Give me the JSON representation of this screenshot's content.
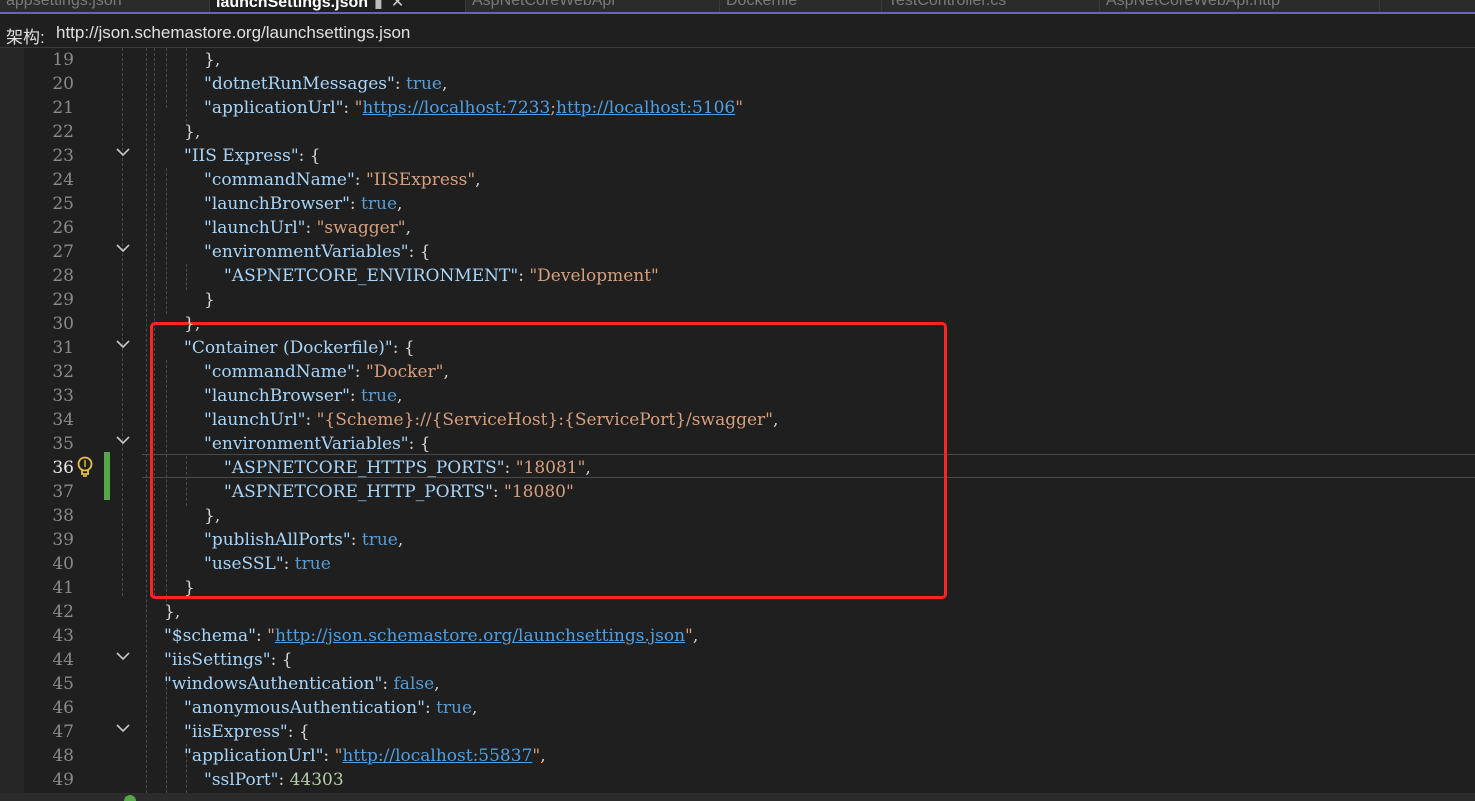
{
  "tabs": [
    {
      "label": "appsettings.json",
      "active": false
    },
    {
      "label": "launchSettings.json",
      "active": true,
      "pin_icon": "pin-icon",
      "close_icon": "close-icon"
    },
    {
      "label": "AspNetCoreWebApi",
      "active": false
    },
    {
      "label": "Dockerfile",
      "active": false
    },
    {
      "label": "TestController.cs",
      "active": false
    },
    {
      "label": "AspNetCoreWebApi.http",
      "active": false
    }
  ],
  "schema_bar": {
    "label": "架构:",
    "url": "http://json.schemastore.org/launchsettings.json"
  },
  "editor": {
    "current_line": 36,
    "lines": [
      {
        "n": "19",
        "fold": false,
        "tokens": [
          {
            "t": "},",
            "c": "p"
          }
        ]
      },
      {
        "n": "20",
        "fold": false,
        "tokens": [
          {
            "t": "\"dotnetRunMessages\"",
            "c": "k"
          },
          {
            "t": ": ",
            "c": "p"
          },
          {
            "t": "true",
            "c": "b"
          },
          {
            "t": ",",
            "c": "p"
          }
        ]
      },
      {
        "n": "21",
        "fold": false,
        "tokens": [
          {
            "t": "\"applicationUrl\"",
            "c": "k"
          },
          {
            "t": ": ",
            "c": "p"
          },
          {
            "t": "\"",
            "c": "s"
          },
          {
            "t": "https://localhost:7233",
            "c": "u"
          },
          {
            "t": ";",
            "c": "s"
          },
          {
            "t": "http://localhost:5106",
            "c": "u"
          },
          {
            "t": "\"",
            "c": "s"
          }
        ]
      },
      {
        "n": "22",
        "fold": false,
        "tokens": [
          {
            "t": "},",
            "c": "p"
          }
        ]
      },
      {
        "n": "23",
        "fold": true,
        "tokens": [
          {
            "t": "\"IIS Express\"",
            "c": "k"
          },
          {
            "t": ": {",
            "c": "p"
          }
        ]
      },
      {
        "n": "24",
        "fold": false,
        "tokens": [
          {
            "t": "\"commandName\"",
            "c": "k"
          },
          {
            "t": ": ",
            "c": "p"
          },
          {
            "t": "\"IISExpress\"",
            "c": "s"
          },
          {
            "t": ",",
            "c": "p"
          }
        ]
      },
      {
        "n": "25",
        "fold": false,
        "tokens": [
          {
            "t": "\"launchBrowser\"",
            "c": "k"
          },
          {
            "t": ": ",
            "c": "p"
          },
          {
            "t": "true",
            "c": "b"
          },
          {
            "t": ",",
            "c": "p"
          }
        ]
      },
      {
        "n": "26",
        "fold": false,
        "tokens": [
          {
            "t": "\"launchUrl\"",
            "c": "k"
          },
          {
            "t": ": ",
            "c": "p"
          },
          {
            "t": "\"swagger\"",
            "c": "s"
          },
          {
            "t": ",",
            "c": "p"
          }
        ]
      },
      {
        "n": "27",
        "fold": true,
        "tokens": [
          {
            "t": "\"environmentVariables\"",
            "c": "k"
          },
          {
            "t": ": {",
            "c": "p"
          }
        ]
      },
      {
        "n": "28",
        "fold": false,
        "tokens": [
          {
            "t": "\"ASPNETCORE_ENVIRONMENT\"",
            "c": "k"
          },
          {
            "t": ": ",
            "c": "p"
          },
          {
            "t": "\"Development\"",
            "c": "s"
          }
        ]
      },
      {
        "n": "29",
        "fold": false,
        "tokens": [
          {
            "t": "}",
            "c": "p"
          }
        ]
      },
      {
        "n": "30",
        "fold": false,
        "tokens": [
          {
            "t": "},",
            "c": "p"
          }
        ]
      },
      {
        "n": "31",
        "fold": true,
        "tokens": [
          {
            "t": "\"Container (Dockerfile)\"",
            "c": "k"
          },
          {
            "t": ": {",
            "c": "p"
          }
        ]
      },
      {
        "n": "32",
        "fold": false,
        "tokens": [
          {
            "t": "\"commandName\"",
            "c": "k"
          },
          {
            "t": ": ",
            "c": "p"
          },
          {
            "t": "\"Docker\"",
            "c": "s"
          },
          {
            "t": ",",
            "c": "p"
          }
        ]
      },
      {
        "n": "33",
        "fold": false,
        "tokens": [
          {
            "t": "\"launchBrowser\"",
            "c": "k"
          },
          {
            "t": ": ",
            "c": "p"
          },
          {
            "t": "true",
            "c": "b"
          },
          {
            "t": ",",
            "c": "p"
          }
        ]
      },
      {
        "n": "34",
        "fold": false,
        "tokens": [
          {
            "t": "\"launchUrl\"",
            "c": "k"
          },
          {
            "t": ": ",
            "c": "p"
          },
          {
            "t": "\"{Scheme}://{ServiceHost}:{ServicePort}/swagger\"",
            "c": "s"
          },
          {
            "t": ",",
            "c": "p"
          }
        ]
      },
      {
        "n": "35",
        "fold": true,
        "tokens": [
          {
            "t": "\"environmentVariables\"",
            "c": "k"
          },
          {
            "t": ": {",
            "c": "p"
          }
        ]
      },
      {
        "n": "36",
        "fold": false,
        "tokens": [
          {
            "t": "\"ASPNETCORE_HTTPS_PORTS\"",
            "c": "k"
          },
          {
            "t": ": ",
            "c": "p"
          },
          {
            "t": "\"18081\"",
            "c": "s"
          },
          {
            "t": ",",
            "c": "p"
          }
        ]
      },
      {
        "n": "37",
        "fold": false,
        "tokens": [
          {
            "t": "\"ASPNETCORE_HTTP_PORTS\"",
            "c": "k"
          },
          {
            "t": ": ",
            "c": "p"
          },
          {
            "t": "\"18080\"",
            "c": "s"
          }
        ]
      },
      {
        "n": "38",
        "fold": false,
        "tokens": [
          {
            "t": "},",
            "c": "p"
          }
        ]
      },
      {
        "n": "39",
        "fold": false,
        "tokens": [
          {
            "t": "\"publishAllPorts\"",
            "c": "k"
          },
          {
            "t": ": ",
            "c": "p"
          },
          {
            "t": "true",
            "c": "b"
          },
          {
            "t": ",",
            "c": "p"
          }
        ]
      },
      {
        "n": "40",
        "fold": false,
        "tokens": [
          {
            "t": "\"useSSL\"",
            "c": "k"
          },
          {
            "t": ": ",
            "c": "p"
          },
          {
            "t": "true",
            "c": "b"
          }
        ]
      },
      {
        "n": "41",
        "fold": false,
        "tokens": [
          {
            "t": "}",
            "c": "p"
          }
        ]
      },
      {
        "n": "42",
        "fold": false,
        "tokens": [
          {
            "t": "},",
            "c": "p"
          }
        ]
      },
      {
        "n": "43",
        "fold": false,
        "tokens": [
          {
            "t": "\"$schema\"",
            "c": "k"
          },
          {
            "t": ": ",
            "c": "p"
          },
          {
            "t": "\"",
            "c": "s"
          },
          {
            "t": "http://json.schemastore.org/launchsettings.json",
            "c": "u"
          },
          {
            "t": "\"",
            "c": "s"
          },
          {
            "t": ",",
            "c": "p"
          }
        ]
      },
      {
        "n": "44",
        "fold": true,
        "tokens": [
          {
            "t": "\"iisSettings\"",
            "c": "k"
          },
          {
            "t": ": {",
            "c": "p"
          }
        ]
      },
      {
        "n": "45",
        "fold": false,
        "tokens": [
          {
            "t": "\"windowsAuthentication\"",
            "c": "k"
          },
          {
            "t": ": ",
            "c": "p"
          },
          {
            "t": "false",
            "c": "b"
          },
          {
            "t": ",",
            "c": "p"
          }
        ]
      },
      {
        "n": "46",
        "fold": false,
        "tokens": [
          {
            "t": "\"anonymousAuthentication\"",
            "c": "k"
          },
          {
            "t": ": ",
            "c": "p"
          },
          {
            "t": "true",
            "c": "b"
          },
          {
            "t": ",",
            "c": "p"
          }
        ]
      },
      {
        "n": "47",
        "fold": true,
        "tokens": [
          {
            "t": "\"iisExpress\"",
            "c": "k"
          },
          {
            "t": ": {",
            "c": "p"
          }
        ]
      },
      {
        "n": "48",
        "fold": false,
        "tokens": [
          {
            "t": "\"applicationUrl\"",
            "c": "k"
          },
          {
            "t": ": ",
            "c": "p"
          },
          {
            "t": "\"",
            "c": "s"
          },
          {
            "t": "http://localhost:55837",
            "c": "u"
          },
          {
            "t": "\"",
            "c": "s"
          },
          {
            "t": ",",
            "c": "p"
          }
        ]
      },
      {
        "n": "49",
        "fold": false,
        "tokens": [
          {
            "t": "\"sslPort\"",
            "c": "k"
          },
          {
            "t": ": ",
            "c": "p"
          },
          {
            "t": "44303",
            "c": "n"
          }
        ]
      }
    ]
  },
  "markers": {
    "lightbulb_icon": "lightbulb-icon",
    "change_bar_color": "#57a64a",
    "highlight_box_color": "#ff2424"
  },
  "colors": {
    "background": "#1f1f1f",
    "key": "#a8d5f8",
    "string": "#d6a07f",
    "keyword": "#569cd6",
    "link": "#4f9fe4",
    "line_number": "#8a8a8a"
  }
}
